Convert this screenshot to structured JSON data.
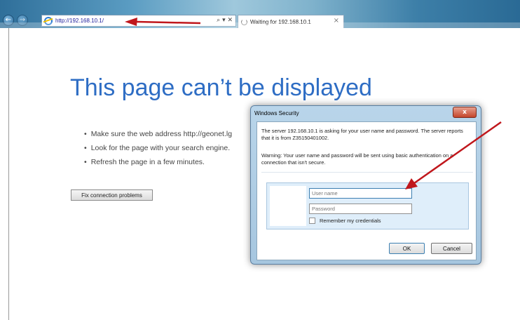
{
  "browser": {
    "url": "http://192.168.10.1/",
    "address_tools": "⌕ ▾ ✕",
    "tab_title": "Waiting for 192.168.10.1",
    "tab_close": "×"
  },
  "page": {
    "title": "This page can’t be displayed",
    "bullets": [
      "Make sure the web address http://geonet.lg",
      "Look for the page with your search engine.",
      "Refresh the page in a few minutes."
    ],
    "fix_button": "Fix connection problems"
  },
  "dialog": {
    "title": "Windows Security",
    "close": "x",
    "message": "The server 192.168.10.1 is asking for your user name and password. The server reports that it is from Z35150401002.",
    "warning": "Warning: Your user name and password will be sent using basic authentication on a connection that isn't secure.",
    "username_placeholder": "User name",
    "password_placeholder": "Password",
    "remember_label": "Remember my credentials",
    "ok": "OK",
    "cancel": "Cancel"
  },
  "colors": {
    "title_blue": "#2e6dc4",
    "arrow_red": "#c0171c"
  },
  "icons": {
    "back": "back-arrow-icon",
    "forward": "forward-arrow-icon",
    "ie": "internet-explorer-icon",
    "loading": "loading-spinner-icon"
  }
}
